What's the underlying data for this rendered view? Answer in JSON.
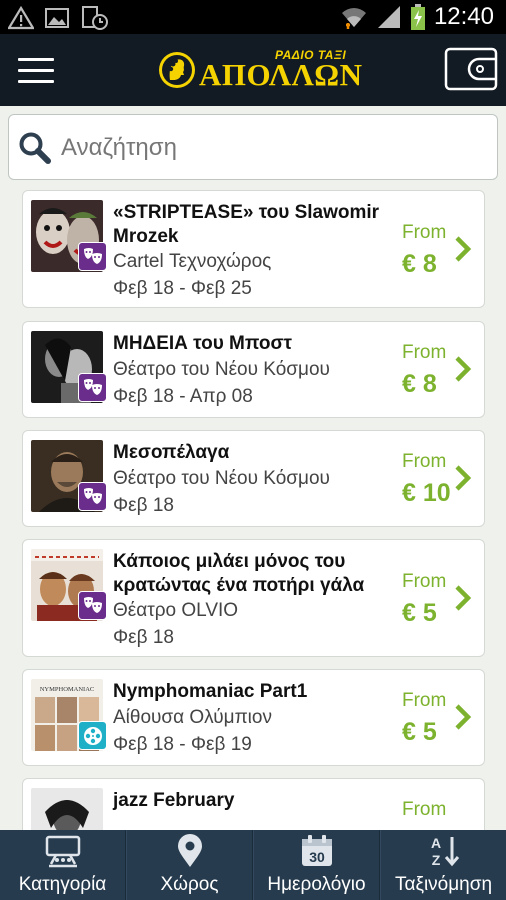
{
  "status_bar": {
    "time": "12:40"
  },
  "header": {
    "logo_small": "ΡΑΔΙΟ ΤΑΞΙ",
    "logo_big": "ΑΠΟΛΛΩΝ"
  },
  "search": {
    "placeholder": "Αναζήτηση"
  },
  "events": [
    {
      "title": "«STRIPTEASE» του Slawomir Mrozek",
      "venue": "Cartel Τεχνοχώρος",
      "dates": "Φεβ 18 - Φεβ 25",
      "from_label": "From",
      "price": "€ 8",
      "category": "theatre-icon"
    },
    {
      "title": "ΜΗΔΕΙΑ του Μποστ",
      "venue": "Θέατρο του Νέου Κόσμου",
      "dates": "Φεβ 18 - Απρ 08",
      "from_label": "From",
      "price": "€ 8",
      "category": "theatre-icon"
    },
    {
      "title": "Μεσοπέλαγα",
      "venue": "Θέατρο του Νέου Κόσμου",
      "dates": "Φεβ 18",
      "from_label": "From",
      "price": "€ 10",
      "category": "theatre-icon"
    },
    {
      "title": "Κάποιος μιλάει μόνος του κρατώντας ένα ποτήρι γάλα",
      "venue": "Θέατρο OLVIO",
      "dates": "Φεβ 18",
      "from_label": "From",
      "price": "€ 5",
      "category": "theatre-icon"
    },
    {
      "title": "Nymphomaniac Part1",
      "venue": "Αίθουσα Ολύμπιον",
      "dates": "Φεβ 18 - Φεβ 19",
      "from_label": "From",
      "price": "€ 5",
      "category": "cinema-icon",
      "poster_text": "NYMPHOMANIAC"
    },
    {
      "title": "jazz February",
      "from_label": "From"
    }
  ],
  "bottom_nav": [
    {
      "label": "Κατηγορία",
      "icon": "category-icon"
    },
    {
      "label": "Χώρος",
      "icon": "location-pin-icon"
    },
    {
      "label": "Ημερολόγιο",
      "icon": "calendar-icon",
      "icon_text": "30"
    },
    {
      "label": "Ταξινόμηση",
      "icon": "sort-az-icon"
    }
  ],
  "colors": {
    "accent": "#7cb22d",
    "header_bg": "#121a24",
    "nav_bg": "#263b4e",
    "logo": "#f5d300",
    "theatre_badge": "#6a2d8c",
    "cinema_badge": "#1fb0c7"
  }
}
